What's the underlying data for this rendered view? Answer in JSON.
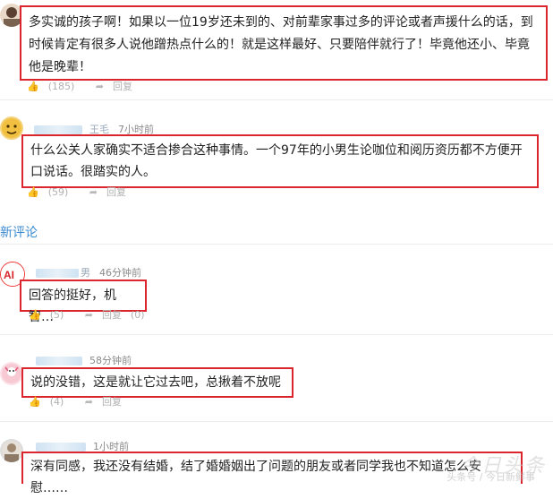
{
  "comments_top": [
    {
      "name": "",
      "time": "",
      "text": "多实诚的孩子啊！如果以一位19岁还未到的、对前辈家事过多的评论或者声援什么的话，到时候肯定有很多人说他蹭热点什么的！就是这样最好、只要陪伴就行了！毕竟他还小、毕竟他是晚辈！",
      "likes": "(185)",
      "reply": "回复"
    },
    {
      "name": "王毛",
      "time": "7小时前",
      "text": "什么公关人家确实不适合掺合这种事情。一个97年的小男生论咖位和阅历资历都不方便开口说话。很踏实的人。",
      "likes": "(59)",
      "reply": "回复"
    }
  ],
  "section": {
    "title": "新评论"
  },
  "comments_new": [
    {
      "name": "男",
      "time": "46分钟前",
      "text": "回答的挺好，机智…",
      "likes": "(5)",
      "reply": "回复",
      "reply_count": "(0)"
    },
    {
      "name": "",
      "time": "58分钟前",
      "text": "说的没错，这是就让它过去吧，总揪着不放呢",
      "likes": "(4)",
      "reply": "回复",
      "reply_count": ""
    },
    {
      "name": "",
      "time": "1小时前",
      "text": "深有同感，我还没有结婚，结了婚婚姻出了问题的朋友或者同学我也不知道怎么安慰……",
      "likes": "",
      "reply": "",
      "reply_count": ""
    }
  ],
  "watermark": {
    "text": "今日头条",
    "small": "头条号 / 今日新鲜事"
  },
  "colors": {
    "highlight_border": "#d9252b",
    "section_title": "#3b8ad0"
  }
}
